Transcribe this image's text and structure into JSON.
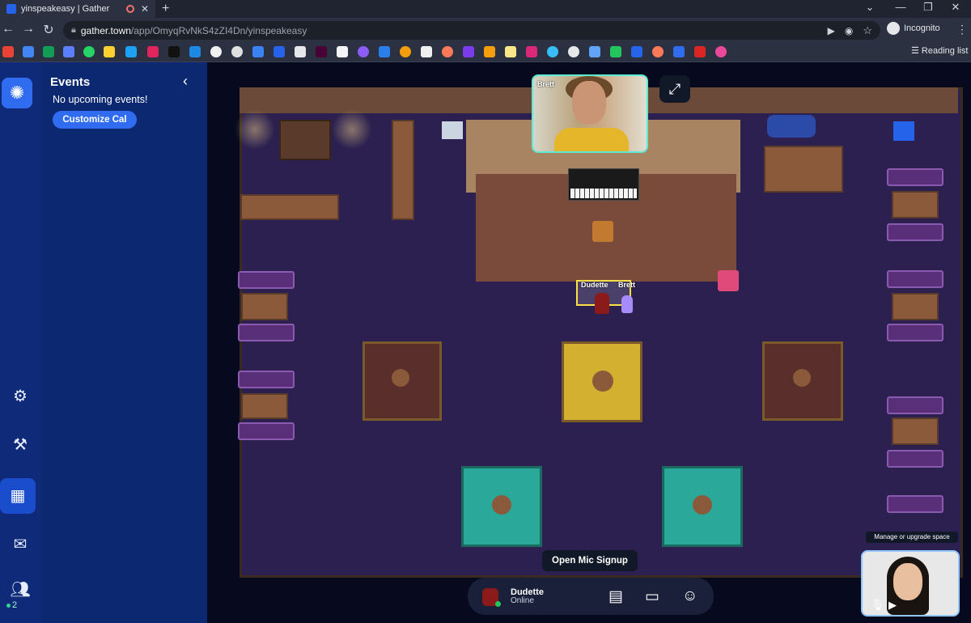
{
  "browser": {
    "tab_title": "yinspeakeasy | Gather",
    "new_tab_icon": "+",
    "url_host": "gather.town",
    "url_path": "/app/OmyqRvNkS4zZI4Dn/yinspeakeasy",
    "incognito_label": "Incognito",
    "reading_list_label": "Reading list"
  },
  "panel": {
    "title": "Events",
    "empty_text": "No upcoming events!",
    "button_label": "Customize Cal"
  },
  "sidebar": {
    "user_count": "2"
  },
  "video": {
    "remote_name": "Brett",
    "manage_label": "Manage or upgrade space"
  },
  "map": {
    "player_name": "Dudette",
    "other_name": "Brett",
    "open_mic_label": "Open Mic Signup"
  },
  "bottom_bar": {
    "name": "Dudette",
    "status": "Online"
  },
  "colors": {
    "sidebar": "#0e2a78",
    "panel": "#0c2870",
    "accent": "#2f6cf0",
    "online": "#22c55e"
  }
}
